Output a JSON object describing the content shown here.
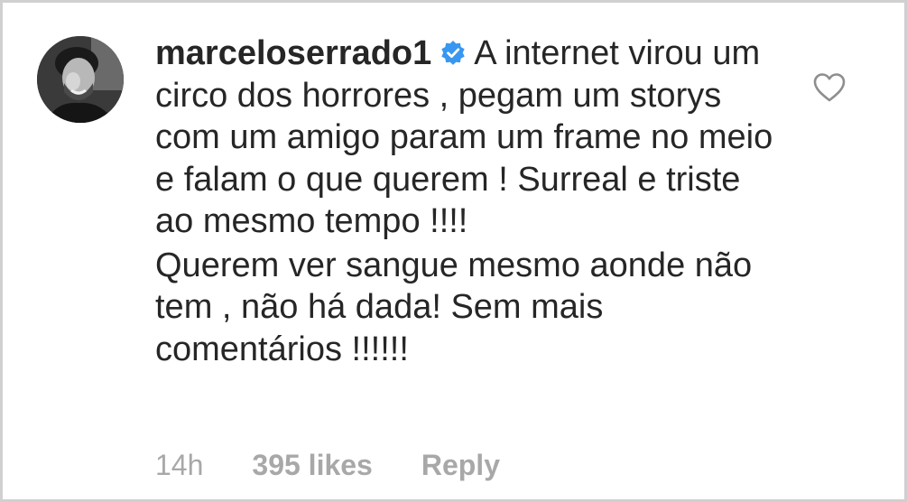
{
  "comment": {
    "username": "marceloserrado1",
    "verified_icon": "verified-badge-icon",
    "paragraphs": [
      "A internet virou um circo dos horrores , pegam um storys com um amigo param um frame no meio e falam o que querem ! Surreal e triste ao mesmo tempo !!!!",
      "Querem ver sangue mesmo aonde não tem , não há dada! Sem mais comentários !!!!!!"
    ]
  },
  "meta": {
    "time": "14h",
    "likes": "395 likes",
    "reply": "Reply"
  },
  "icons": {
    "like": "heart-outline-icon",
    "avatar": "profile-photo"
  },
  "colors": {
    "text": "#262626",
    "muted": "#a8a8a8",
    "verified": "#3897f0",
    "border": "#d0d0d0"
  }
}
